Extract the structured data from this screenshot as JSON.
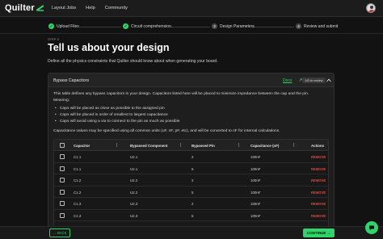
{
  "brand": {
    "name": "Quilter",
    "accent": "#2fd46b"
  },
  "nav": {
    "links": [
      "Layout Jobs",
      "Help",
      "Community"
    ]
  },
  "stepper": {
    "steps": [
      {
        "label": "Upload Files",
        "status": "done",
        "marker": "✓"
      },
      {
        "label": "Circuit comprehension",
        "status": "done",
        "marker": "✓"
      },
      {
        "label": "Design Parameters",
        "status": "todo",
        "marker": "3"
      },
      {
        "label": "Review and submit",
        "status": "todo",
        "marker": "4"
      }
    ]
  },
  "page": {
    "step_tag": "STEP 3",
    "title": "Tell us about your design",
    "subtitle": "Define all the physics constraints that Quilter should know about when generating your board."
  },
  "panel": {
    "title": "Bypass Capacitors",
    "docs_link": "Docs",
    "review_badge": "1/8 to review",
    "description": "This table defines any bypass capacitors in your design. Capacitors listed here will be placed to minimize impedance between the cap and the pin.",
    "meaning_label": "Meaning:",
    "bullets": [
      "Caps will be placed as close as possible to the assigned pin",
      "Caps will be placed in order of smallest to largest capacitance",
      "Caps will avoid using a via to connect to the pin as much as possible"
    ],
    "units_note": "Capacitance values may be specified using all common units (uF, nF, pF, etc), and will be converted to nF for internal calculations."
  },
  "table": {
    "columns": [
      "Capacitor",
      "Bypassed Component",
      "Bypassed Pin",
      "Capacitance (nF)",
      "Actions"
    ],
    "rows": [
      {
        "capacitor": "C1.1",
        "component": "U2.1",
        "pin": "2",
        "capacitance": "100nF",
        "action": "REMOVE"
      },
      {
        "capacitor": "C1.1",
        "component": "U2.1",
        "pin": "5",
        "capacitance": "100nF",
        "action": "REMOVE"
      },
      {
        "capacitor": "C1.2",
        "component": "U2.2",
        "pin": "2",
        "capacitance": "100nF",
        "action": "REMOVE"
      },
      {
        "capacitor": "C1.2",
        "component": "U2.2",
        "pin": "5",
        "capacitance": "100nF",
        "action": "REMOVE"
      },
      {
        "capacitor": "C1.3",
        "component": "U2.3",
        "pin": "2",
        "capacitance": "100nF",
        "action": "REMOVE"
      },
      {
        "capacitor": "C1.3",
        "component": "U2.3",
        "pin": "5",
        "capacitance": "100nF",
        "action": "REMOVE"
      }
    ]
  },
  "footer": {
    "back_label": "← BACK",
    "continue_label": "CONTINUE →"
  }
}
